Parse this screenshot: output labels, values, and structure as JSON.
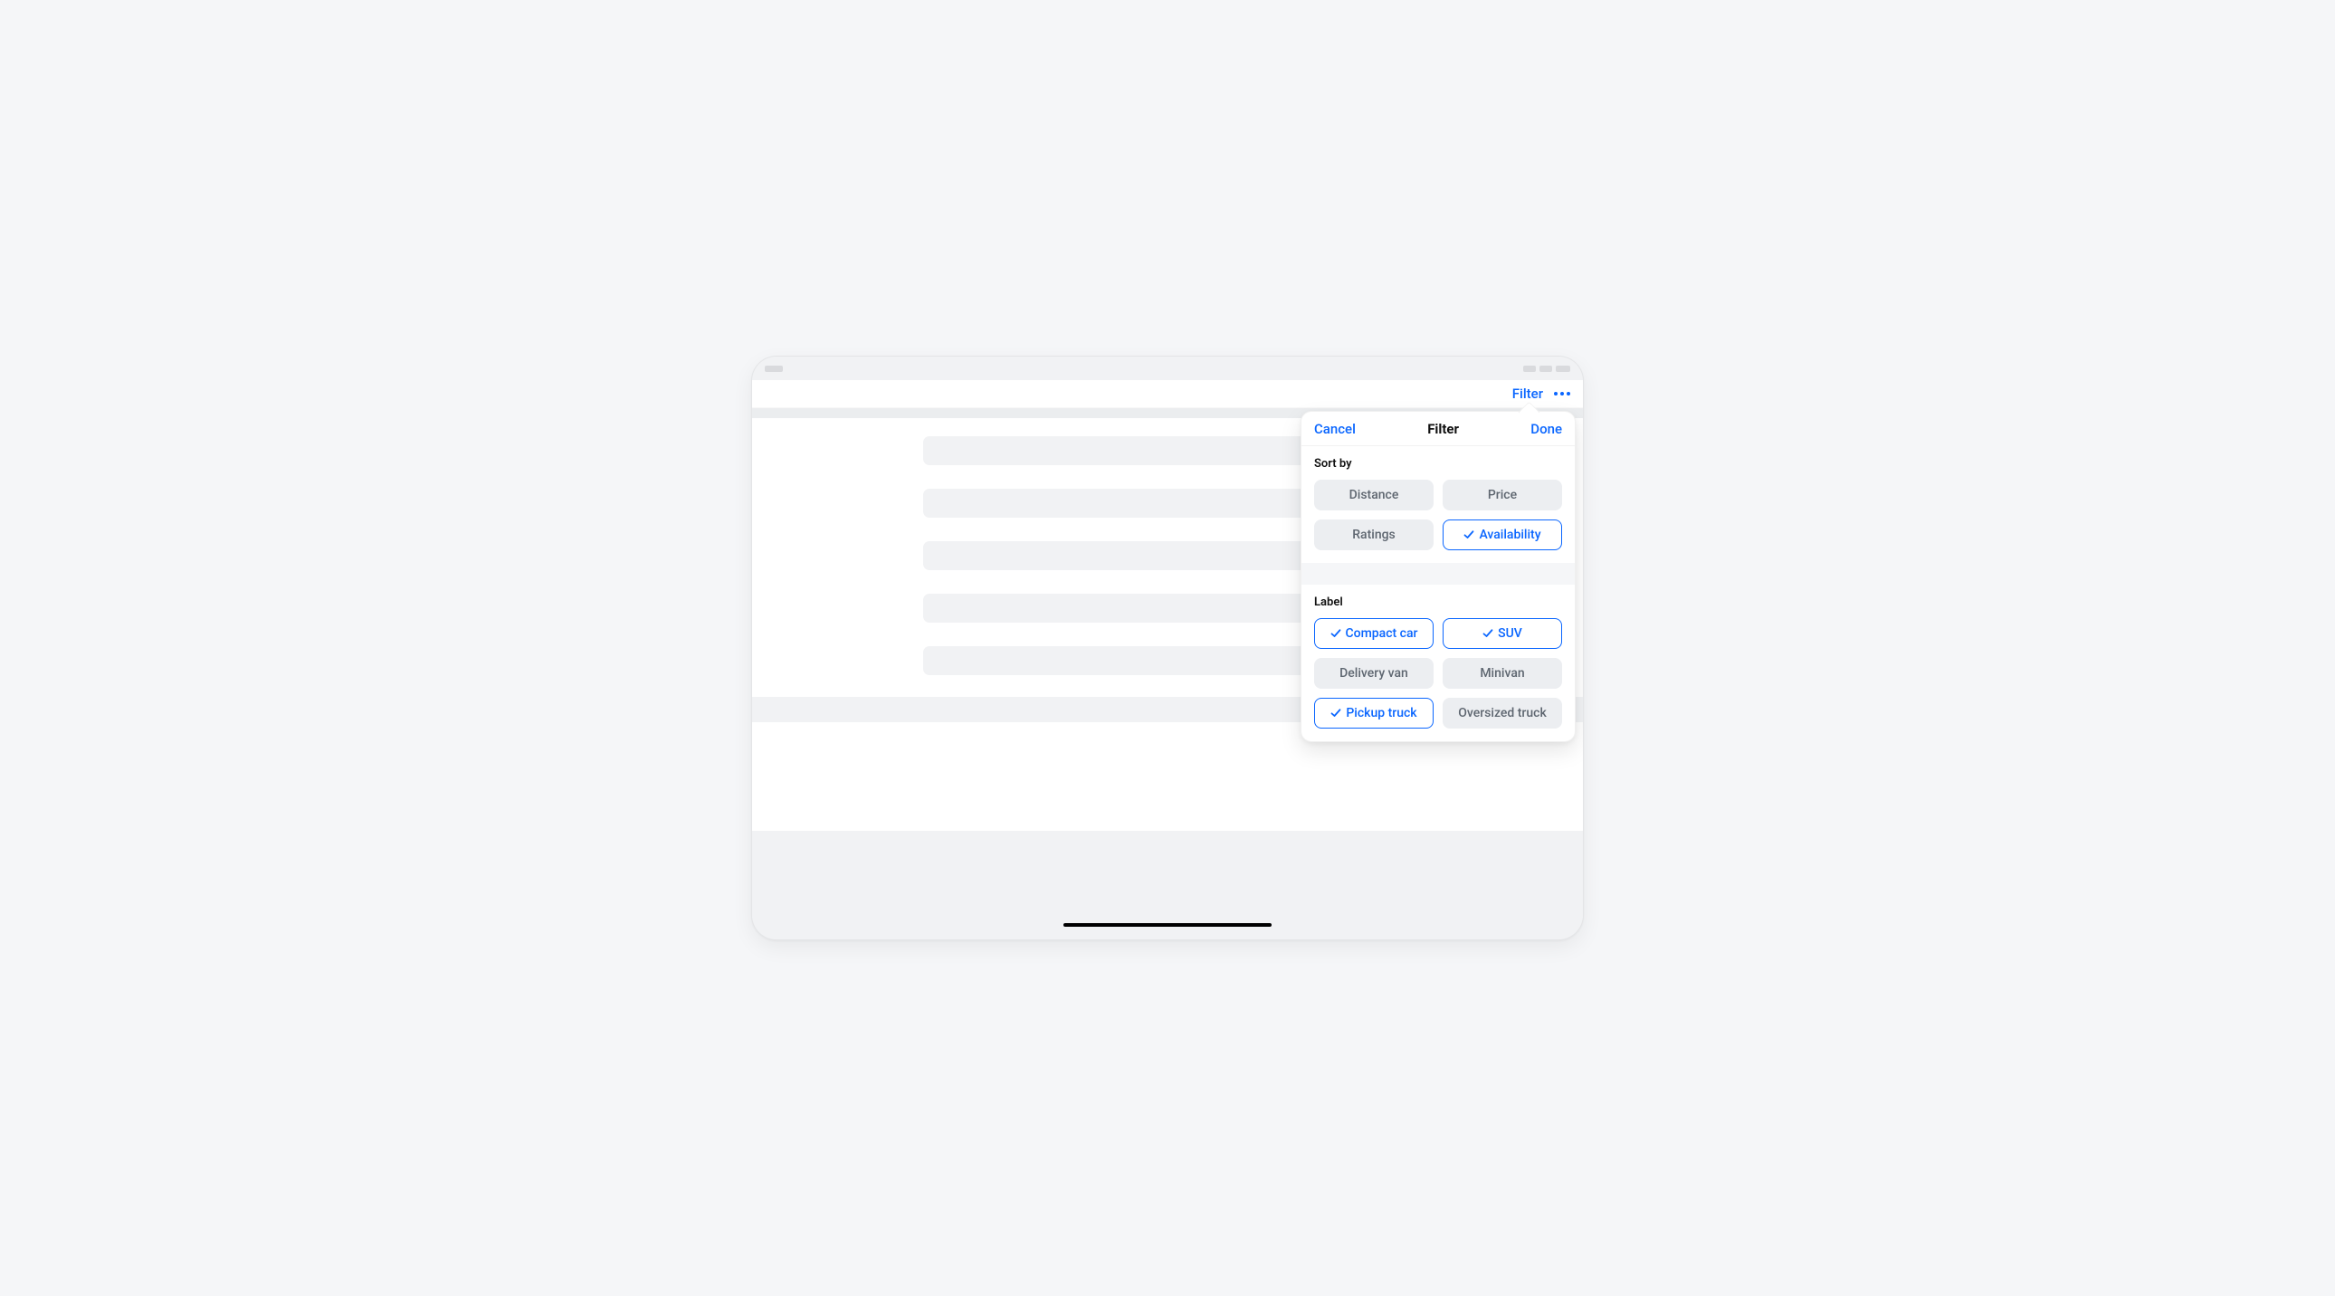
{
  "nav": {
    "filter_label": "Filter"
  },
  "popover": {
    "cancel_label": "Cancel",
    "title": "Filter",
    "done_label": "Done",
    "sort": {
      "title": "Sort by",
      "options": {
        "distance": {
          "label": "Distance",
          "selected": false
        },
        "price": {
          "label": "Price",
          "selected": false
        },
        "ratings": {
          "label": "Ratings",
          "selected": false
        },
        "availability": {
          "label": "Availability",
          "selected": true
        }
      }
    },
    "labels": {
      "title": "Label",
      "options": {
        "compact_car": {
          "label": "Compact car",
          "selected": true
        },
        "suv": {
          "label": "SUV",
          "selected": true
        },
        "delivery_van": {
          "label": "Delivery van",
          "selected": false
        },
        "minivan": {
          "label": "Minivan",
          "selected": false
        },
        "pickup_truck": {
          "label": "Pickup truck",
          "selected": true
        },
        "oversized_truck": {
          "label": "Oversized truck",
          "selected": false
        }
      }
    }
  },
  "colors": {
    "accent": "#0a66ff"
  }
}
